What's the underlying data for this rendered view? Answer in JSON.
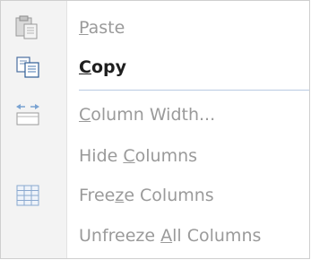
{
  "menu": {
    "items": [
      {
        "label": "Paste",
        "mnemonic": "P",
        "enabled": false,
        "icon": "paste-icon"
      },
      {
        "label": "Copy",
        "mnemonic": "C",
        "enabled": true,
        "icon": "copy-icon"
      },
      {
        "label": "Column Width...",
        "mnemonic": "C",
        "enabled": false,
        "icon": "column-width-icon"
      },
      {
        "label": "Hide Columns",
        "mnemonic": "C",
        "mnemonic_index": 5,
        "enabled": false,
        "icon": null
      },
      {
        "label": "Freeze Columns",
        "mnemonic": "z",
        "mnemonic_index": 4,
        "enabled": false,
        "icon": "freeze-columns-icon"
      },
      {
        "label": "Unfreeze All Columns",
        "mnemonic": "A",
        "mnemonic_index": 9,
        "enabled": false,
        "icon": null
      }
    ]
  }
}
